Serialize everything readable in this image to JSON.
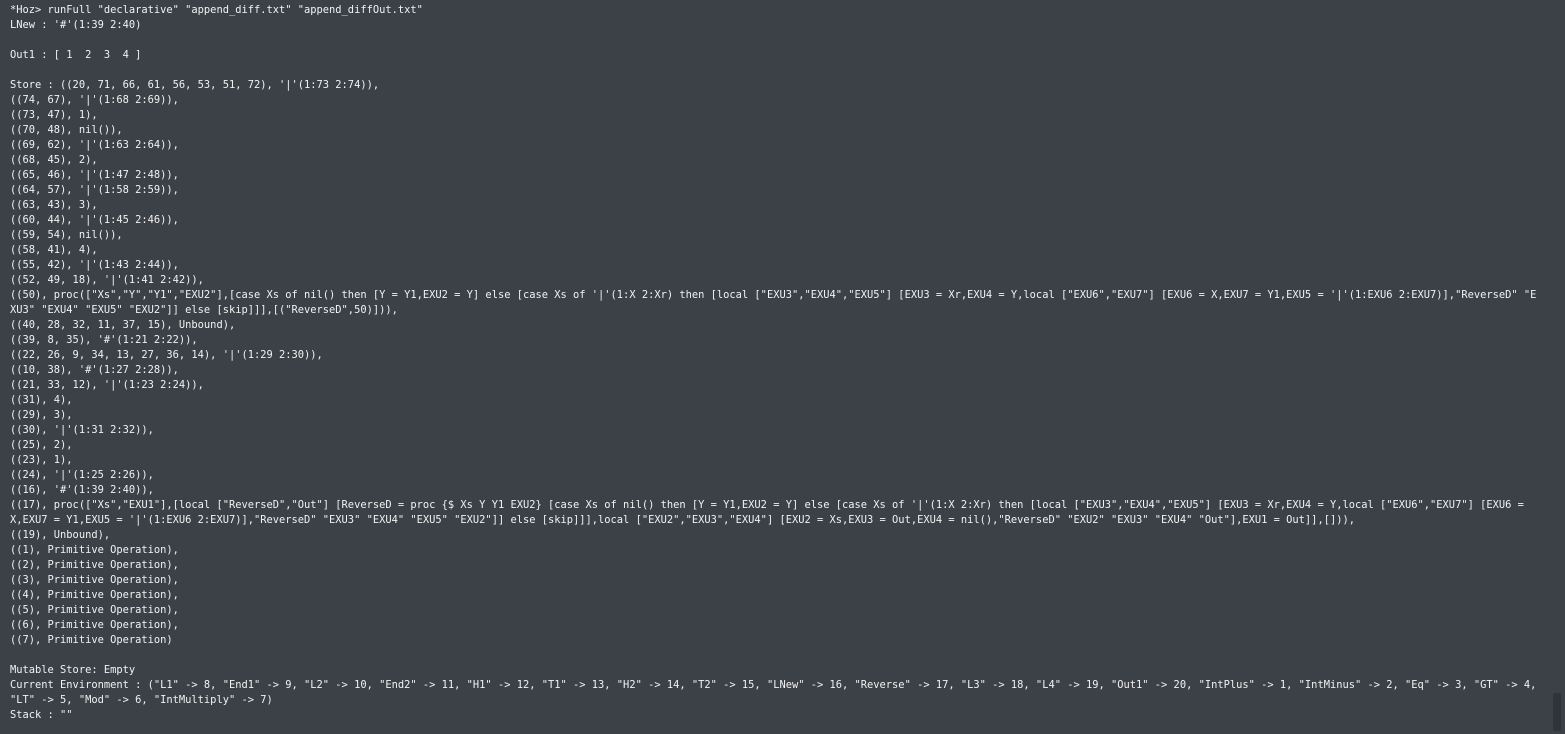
{
  "terminal": {
    "lines": [
      "*Hoz> runFull \"declarative\" \"append_diff.txt\" \"append_diffOut.txt\"",
      "LNew : '#'(1:39 2:40)",
      "",
      "Out1 : [ 1  2  3  4 ]",
      "",
      "Store : ((20, 71, 66, 61, 56, 53, 51, 72), '|'(1:73 2:74)),",
      "((74, 67), '|'(1:68 2:69)),",
      "((73, 47), 1),",
      "((70, 48), nil()),",
      "((69, 62), '|'(1:63 2:64)),",
      "((68, 45), 2),",
      "((65, 46), '|'(1:47 2:48)),",
      "((64, 57), '|'(1:58 2:59)),",
      "((63, 43), 3),",
      "((60, 44), '|'(1:45 2:46)),",
      "((59, 54), nil()),",
      "((58, 41), 4),",
      "((55, 42), '|'(1:43 2:44)),",
      "((52, 49, 18), '|'(1:41 2:42)),",
      "((50), proc([\"Xs\",\"Y\",\"Y1\",\"EXU2\"],[case Xs of nil() then [Y = Y1,EXU2 = Y] else [case Xs of '|'(1:X 2:Xr) then [local [\"EXU3\",\"EXU4\",\"EXU5\"] [EXU3 = Xr,EXU4 = Y,local [\"EXU6\",\"EXU7\"] [EXU6 = X,EXU7 = Y1,EXU5 = '|'(1:EXU6 2:EXU7)],\"ReverseD\" \"EXU3\" \"EXU4\" \"EXU5\" \"EXU2\"]] else [skip]]],[(\"ReverseD\",50)])),",
      "((40, 28, 32, 11, 37, 15), Unbound),",
      "((39, 8, 35), '#'(1:21 2:22)),",
      "((22, 26, 9, 34, 13, 27, 36, 14), '|'(1:29 2:30)),",
      "((10, 38), '#'(1:27 2:28)),",
      "((21, 33, 12), '|'(1:23 2:24)),",
      "((31), 4),",
      "((29), 3),",
      "((30), '|'(1:31 2:32)),",
      "((25), 2),",
      "((23), 1),",
      "((24), '|'(1:25 2:26)),",
      "((16), '#'(1:39 2:40)),",
      "((17), proc([\"Xs\",\"EXU1\"],[local [\"ReverseD\",\"Out\"] [ReverseD = proc {$ Xs Y Y1 EXU2} [case Xs of nil() then [Y = Y1,EXU2 = Y] else [case Xs of '|'(1:X 2:Xr) then [local [\"EXU3\",\"EXU4\",\"EXU5\"] [EXU3 = Xr,EXU4 = Y,local [\"EXU6\",\"EXU7\"] [EXU6 = X,EXU7 = Y1,EXU5 = '|'(1:EXU6 2:EXU7)],\"ReverseD\" \"EXU3\" \"EXU4\" \"EXU5\" \"EXU2\"]] else [skip]]],local [\"EXU2\",\"EXU3\",\"EXU4\"] [EXU2 = Xs,EXU3 = Out,EXU4 = nil(),\"ReverseD\" \"EXU2\" \"EXU3\" \"EXU4\" \"Out\"],EXU1 = Out]],[])),",
      "((19), Unbound),",
      "((1), Primitive Operation),",
      "((2), Primitive Operation),",
      "((3), Primitive Operation),",
      "((4), Primitive Operation),",
      "((5), Primitive Operation),",
      "((6), Primitive Operation),",
      "((7), Primitive Operation)",
      "",
      "Mutable Store: Empty",
      "Current Environment : (\"L1\" -> 8, \"End1\" -> 9, \"L2\" -> 10, \"End2\" -> 11, \"H1\" -> 12, \"T1\" -> 13, \"H2\" -> 14, \"T2\" -> 15, \"LNew\" -> 16, \"Reverse\" -> 17, \"L3\" -> 18, \"L4\" -> 19, \"Out1\" -> 20, \"IntPlus\" -> 1, \"IntMinus\" -> 2, \"Eq\" -> 3, \"GT\" -> 4, \"LT\" -> 5, \"Mod\" -> 6, \"IntMultiply\" -> 7)",
      "Stack : \"\""
    ]
  }
}
